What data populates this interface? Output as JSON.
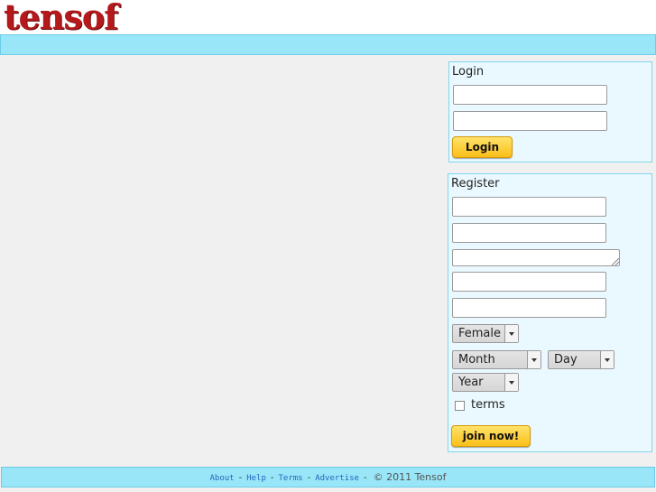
{
  "brand": {
    "logo_text": "tensof"
  },
  "login": {
    "title": "Login",
    "username_value": "",
    "password_value": "",
    "button_label": "Login"
  },
  "register": {
    "title": "Register",
    "field1_value": "",
    "field2_value": "",
    "field3_value": "",
    "field4_value": "",
    "field5_value": "",
    "gender_selected": "Female",
    "month_selected": "Month",
    "day_selected": "Day",
    "year_selected": "Year",
    "terms_label": "terms",
    "terms_checked": false,
    "join_label": "join now!"
  },
  "footer": {
    "links": [
      "About",
      "Help",
      "Terms",
      "Advertise"
    ],
    "separator": "-",
    "copyright": "© 2011 Tensof"
  },
  "colors": {
    "brand_red": "#b5191c",
    "nav_blue": "#99e6f8",
    "button_yellow": "#fbbf1a"
  }
}
